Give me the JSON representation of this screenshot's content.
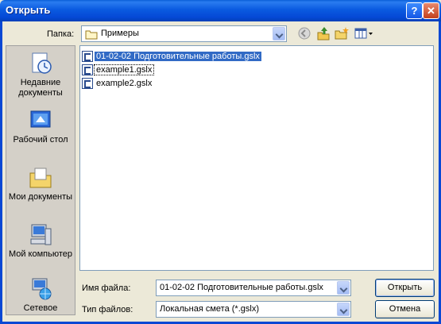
{
  "window": {
    "title": "Открыть",
    "help_glyph": "?",
    "close_glyph": "✕"
  },
  "lookin": {
    "label": "Папка:",
    "value": "Примеры"
  },
  "toolbar": {
    "back_icon": "back-icon",
    "up_icon": "up-folder-icon",
    "newfolder_icon": "new-folder-icon",
    "views_icon": "views-menu-icon"
  },
  "places": [
    {
      "label": "Недавние документы",
      "icon": "recent-documents-icon"
    },
    {
      "label": "Рабочий стол",
      "icon": "desktop-icon"
    },
    {
      "label": "Мои документы",
      "icon": "my-documents-icon"
    },
    {
      "label": "Мой компьютер",
      "icon": "my-computer-icon"
    },
    {
      "label": "Сетевое",
      "icon": "network-icon"
    }
  ],
  "files": [
    {
      "name": "01-02-02 Подготовительные работы.gslx",
      "selected": true
    },
    {
      "name": "example1.gslx",
      "focused": true
    },
    {
      "name": "example2.gslx"
    }
  ],
  "filename": {
    "label": "Имя файла:",
    "value": "01-02-02 Подготовительные работы.gslx"
  },
  "filetype": {
    "label": "Тип файлов:",
    "value": "Локальная смета (*.gslx)"
  },
  "buttons": {
    "open": "Открыть",
    "cancel": "Отмена"
  }
}
